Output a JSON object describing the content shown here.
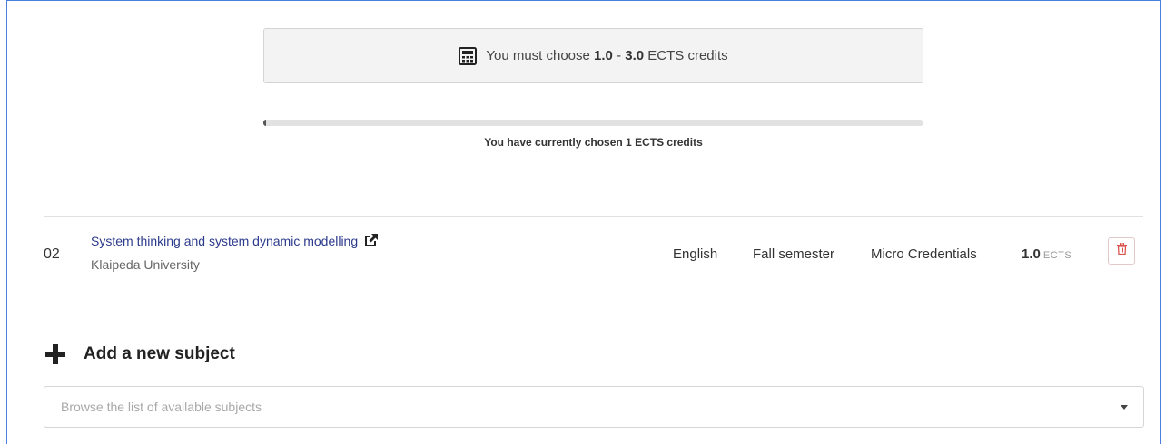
{
  "credit_requirement": {
    "prefix": "You must choose",
    "min": "1.0",
    "separator": "-",
    "max": "3.0",
    "suffix": "ECTS credits",
    "icon": "calculator-icon"
  },
  "progress": {
    "fraction": 0.004,
    "text": "You have currently chosen 1 ECTS credits"
  },
  "subjects": [
    {
      "number": "02",
      "title": "System thinking and system dynamic modelling",
      "university": "Klaipeda University",
      "language": "English",
      "semester": "Fall semester",
      "type": "Micro Credentials",
      "credits": "1.0",
      "credits_unit": "ECTS",
      "external_link_icon": "external-link-icon",
      "delete_icon": "trash-icon"
    }
  ],
  "add_subject": {
    "label": "Add a new subject",
    "icon": "plus-icon",
    "dropdown_placeholder": "Browse the list of available subjects"
  },
  "colors": {
    "link": "#2c3a8c",
    "delete": "#d9534f",
    "frame": "#4a7ee0"
  }
}
